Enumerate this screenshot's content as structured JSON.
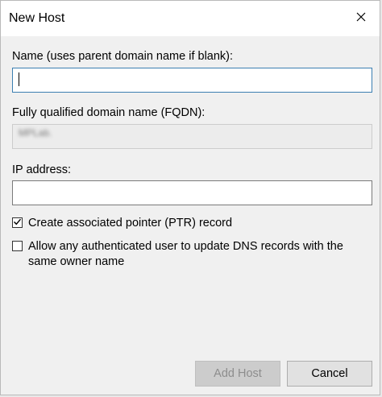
{
  "dialog": {
    "title": "New Host",
    "close_icon": "close-icon"
  },
  "form": {
    "name_label": "Name (uses parent domain name if blank):",
    "name_value": "",
    "fqdn_label": "Fully qualified domain name (FQDN):",
    "fqdn_value": "MPLab.",
    "ip_label": "IP address:",
    "ip_value": "",
    "ptr_checkbox": {
      "label": "Create associated pointer (PTR) record",
      "checked": true
    },
    "allow_update_checkbox": {
      "label": "Allow any authenticated user to update DNS records with the same owner name",
      "checked": false
    }
  },
  "buttons": {
    "add_host_label": "Add Host",
    "add_host_enabled": false,
    "cancel_label": "Cancel"
  }
}
